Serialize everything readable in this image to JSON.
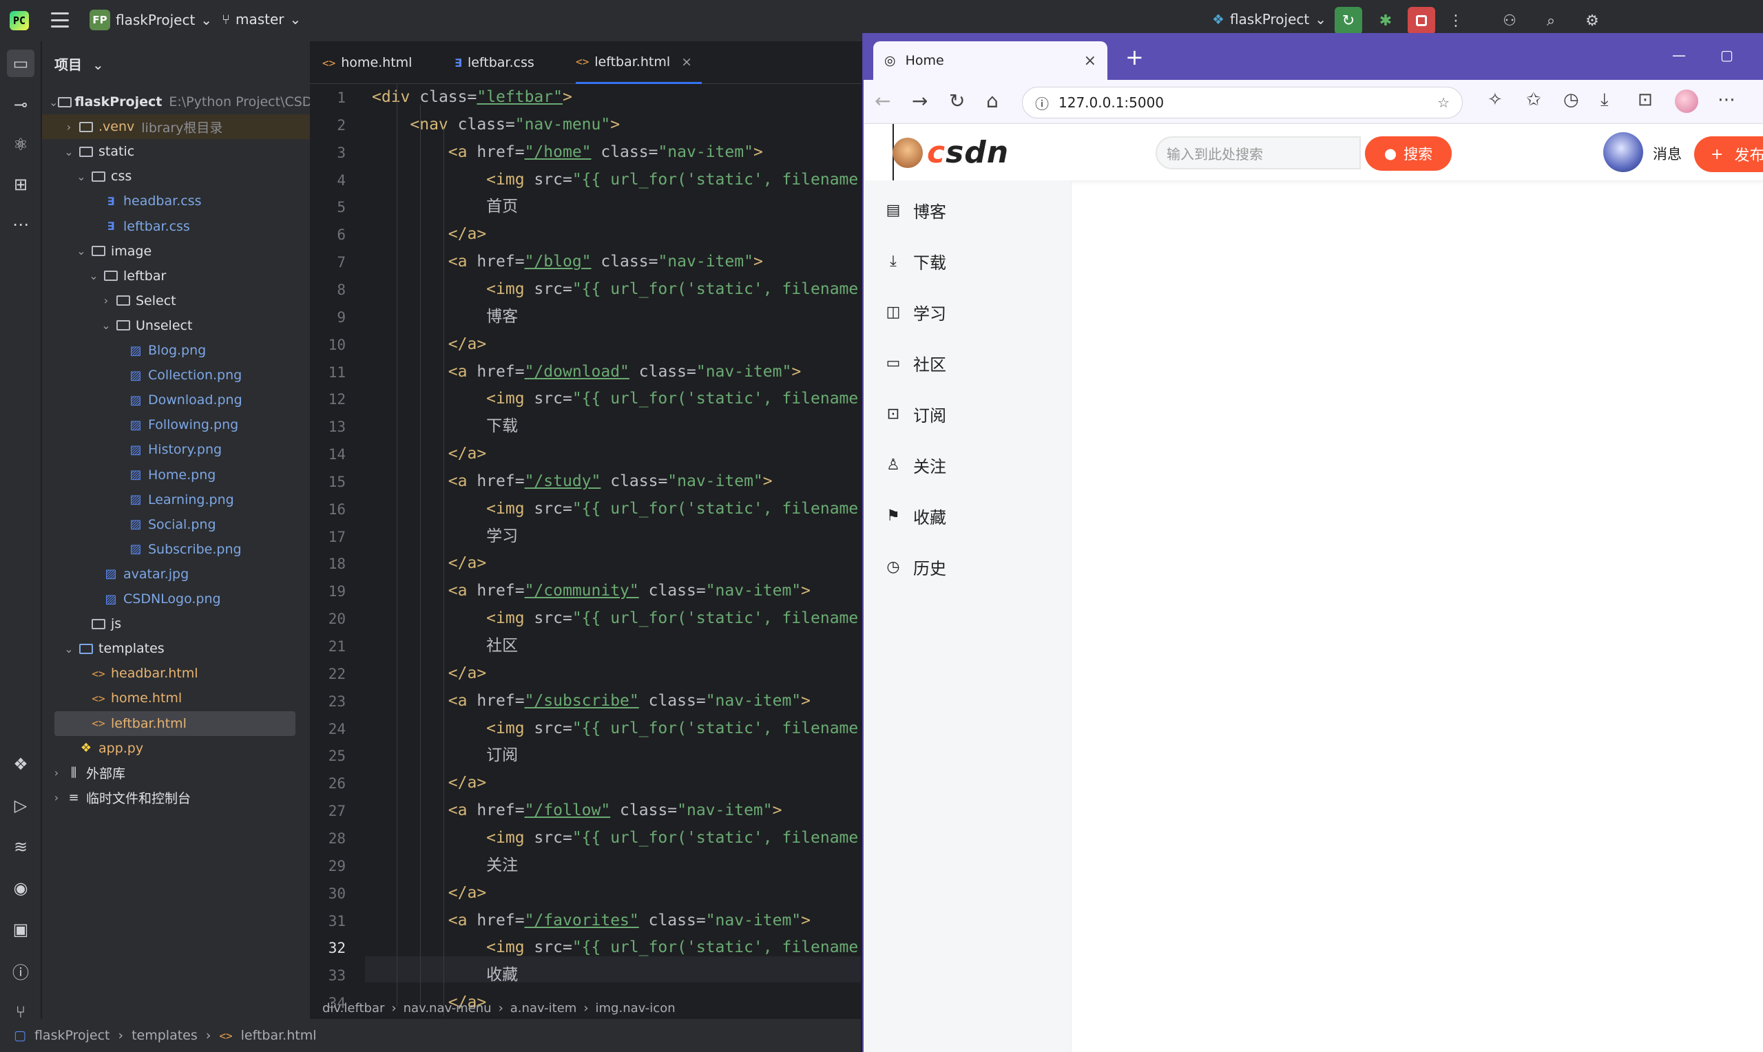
{
  "ide": {
    "logo_text": "PC",
    "project_badge": "FP",
    "project_name": "flaskProject",
    "branch": "master",
    "run_config": "flaskProject",
    "panel_title": "项目",
    "tree": [
      {
        "label": "flaskProject",
        "extra": "E:\\Python Project\\CSDN",
        "depth": 0,
        "type": "folder",
        "open": true,
        "bold": true
      },
      {
        "label": ".venv",
        "extra": "library根目录",
        "depth": 1,
        "type": "folder",
        "open": false,
        "excluded": true
      },
      {
        "label": "static",
        "depth": 1,
        "type": "folder",
        "open": true
      },
      {
        "label": "css",
        "depth": 2,
        "type": "folder",
        "open": true
      },
      {
        "label": "headbar.css",
        "depth": 3,
        "type": "css"
      },
      {
        "label": "leftbar.css",
        "depth": 3,
        "type": "css"
      },
      {
        "label": "image",
        "depth": 2,
        "type": "folder",
        "open": true
      },
      {
        "label": "leftbar",
        "depth": 3,
        "type": "folder",
        "open": true
      },
      {
        "label": "Select",
        "depth": 4,
        "type": "folder",
        "open": false
      },
      {
        "label": "Unselect",
        "depth": 4,
        "type": "folder",
        "open": true
      },
      {
        "label": "Blog.png",
        "depth": 5,
        "type": "png"
      },
      {
        "label": "Collection.png",
        "depth": 5,
        "type": "png"
      },
      {
        "label": "Download.png",
        "depth": 5,
        "type": "png"
      },
      {
        "label": "Following.png",
        "depth": 5,
        "type": "png"
      },
      {
        "label": "History.png",
        "depth": 5,
        "type": "png"
      },
      {
        "label": "Home.png",
        "depth": 5,
        "type": "png"
      },
      {
        "label": "Learning.png",
        "depth": 5,
        "type": "png"
      },
      {
        "label": "Social.png",
        "depth": 5,
        "type": "png"
      },
      {
        "label": "Subscribe.png",
        "depth": 5,
        "type": "png"
      },
      {
        "label": "avatar.jpg",
        "depth": 3,
        "type": "png"
      },
      {
        "label": "CSDNLogo.png",
        "depth": 3,
        "type": "png"
      },
      {
        "label": "js",
        "depth": 2,
        "type": "folder",
        "open": null
      },
      {
        "label": "templates",
        "depth": 1,
        "type": "folder",
        "open": true,
        "blue": true
      },
      {
        "label": "headbar.html",
        "depth": 2,
        "type": "html"
      },
      {
        "label": "home.html",
        "depth": 2,
        "type": "html"
      },
      {
        "label": "leftbar.html",
        "depth": 2,
        "type": "html",
        "selected": true
      },
      {
        "label": "app.py",
        "depth": 1,
        "type": "py"
      },
      {
        "label": "外部库",
        "depth": 0,
        "type": "lib",
        "open": false
      },
      {
        "label": "临时文件和控制台",
        "depth": 0,
        "type": "scratch",
        "open": false
      }
    ],
    "tabs": [
      {
        "label": "home.html",
        "type": "html"
      },
      {
        "label": "leftbar.css",
        "type": "css"
      },
      {
        "label": "leftbar.html",
        "type": "html",
        "active": true
      }
    ],
    "current_line": 32,
    "code": [
      [
        [
          "tg",
          "<div "
        ],
        [
          "at",
          "class="
        ],
        [
          "av",
          "\"leftbar\""
        ],
        [
          "tg",
          ">"
        ]
      ],
      [
        [
          "cn",
          "    "
        ],
        [
          "tg",
          "<nav "
        ],
        [
          "at",
          "class="
        ],
        [
          "av",
          "\"nav-menu\""
        ],
        [
          "tg",
          ">"
        ]
      ],
      [
        [
          "cn",
          "        "
        ],
        [
          "tg",
          "<a "
        ],
        [
          "at",
          "href="
        ],
        [
          "av",
          "\"/home\""
        ],
        [
          "at",
          " class="
        ],
        [
          "av",
          "\"nav-item\""
        ],
        [
          "tg",
          ">"
        ]
      ],
      [
        [
          "cn",
          "            "
        ],
        [
          "tg",
          "<img "
        ],
        [
          "at",
          "src="
        ],
        [
          "av",
          "\"{{ url_for("
        ],
        [
          "av",
          "'static'"
        ],
        [
          "av",
          ", filename"
        ]
      ],
      [
        [
          "cn",
          "            首页"
        ]
      ],
      [
        [
          "cn",
          "        "
        ],
        [
          "tg",
          "</a>"
        ]
      ],
      [
        [
          "cn",
          "        "
        ],
        [
          "tg",
          "<a "
        ],
        [
          "at",
          "href="
        ],
        [
          "av",
          "\"/blog\""
        ],
        [
          "at",
          " class="
        ],
        [
          "av",
          "\"nav-item\""
        ],
        [
          "tg",
          ">"
        ]
      ],
      [
        [
          "cn",
          "            "
        ],
        [
          "tg",
          "<img "
        ],
        [
          "at",
          "src="
        ],
        [
          "av",
          "\"{{ url_for("
        ],
        [
          "av",
          "'static'"
        ],
        [
          "av",
          ", filename"
        ]
      ],
      [
        [
          "cn",
          "            博客"
        ]
      ],
      [
        [
          "cn",
          "        "
        ],
        [
          "tg",
          "</a>"
        ]
      ],
      [
        [
          "cn",
          "        "
        ],
        [
          "tg",
          "<a "
        ],
        [
          "at",
          "href="
        ],
        [
          "av",
          "\"/download\""
        ],
        [
          "at",
          " class="
        ],
        [
          "av",
          "\"nav-item\""
        ],
        [
          "tg",
          ">"
        ]
      ],
      [
        [
          "cn",
          "            "
        ],
        [
          "tg",
          "<img "
        ],
        [
          "at",
          "src="
        ],
        [
          "av",
          "\"{{ url_for("
        ],
        [
          "av",
          "'static'"
        ],
        [
          "av",
          ", filename"
        ]
      ],
      [
        [
          "cn",
          "            下载"
        ]
      ],
      [
        [
          "cn",
          "        "
        ],
        [
          "tg",
          "</a>"
        ]
      ],
      [
        [
          "cn",
          "        "
        ],
        [
          "tg",
          "<a "
        ],
        [
          "at",
          "href="
        ],
        [
          "av",
          "\"/study\""
        ],
        [
          "at",
          " class="
        ],
        [
          "av",
          "\"nav-item\""
        ],
        [
          "tg",
          ">"
        ]
      ],
      [
        [
          "cn",
          "            "
        ],
        [
          "tg",
          "<img "
        ],
        [
          "at",
          "src="
        ],
        [
          "av",
          "\"{{ url_for("
        ],
        [
          "av",
          "'static'"
        ],
        [
          "av",
          ", filename"
        ]
      ],
      [
        [
          "cn",
          "            学习"
        ]
      ],
      [
        [
          "cn",
          "        "
        ],
        [
          "tg",
          "</a>"
        ]
      ],
      [
        [
          "cn",
          "        "
        ],
        [
          "tg",
          "<a "
        ],
        [
          "at",
          "href="
        ],
        [
          "av",
          "\"/community\""
        ],
        [
          "at",
          " class="
        ],
        [
          "av",
          "\"nav-item\""
        ],
        [
          "tg",
          ">"
        ]
      ],
      [
        [
          "cn",
          "            "
        ],
        [
          "tg",
          "<img "
        ],
        [
          "at",
          "src="
        ],
        [
          "av",
          "\"{{ url_for("
        ],
        [
          "av",
          "'static'"
        ],
        [
          "av",
          ", filename"
        ]
      ],
      [
        [
          "cn",
          "            社区"
        ]
      ],
      [
        [
          "cn",
          "        "
        ],
        [
          "tg",
          "</a>"
        ]
      ],
      [
        [
          "cn",
          "        "
        ],
        [
          "tg",
          "<a "
        ],
        [
          "at",
          "href="
        ],
        [
          "av",
          "\"/subscribe\""
        ],
        [
          "at",
          " class="
        ],
        [
          "av",
          "\"nav-item\""
        ],
        [
          "tg",
          ">"
        ]
      ],
      [
        [
          "cn",
          "            "
        ],
        [
          "tg",
          "<img "
        ],
        [
          "at",
          "src="
        ],
        [
          "av",
          "\"{{ url_for("
        ],
        [
          "av",
          "'static'"
        ],
        [
          "av",
          ", filename"
        ]
      ],
      [
        [
          "cn",
          "            订阅"
        ]
      ],
      [
        [
          "cn",
          "        "
        ],
        [
          "tg",
          "</a>"
        ]
      ],
      [
        [
          "cn",
          "        "
        ],
        [
          "tg",
          "<a "
        ],
        [
          "at",
          "href="
        ],
        [
          "av",
          "\"/follow\""
        ],
        [
          "at",
          " class="
        ],
        [
          "av",
          "\"nav-item\""
        ],
        [
          "tg",
          ">"
        ]
      ],
      [
        [
          "cn",
          "            "
        ],
        [
          "tg",
          "<img "
        ],
        [
          "at",
          "src="
        ],
        [
          "av",
          "\"{{ url_for("
        ],
        [
          "av",
          "'static'"
        ],
        [
          "av",
          ", filename"
        ]
      ],
      [
        [
          "cn",
          "            关注"
        ]
      ],
      [
        [
          "cn",
          "        "
        ],
        [
          "tg",
          "</a>"
        ]
      ],
      [
        [
          "cn",
          "        "
        ],
        [
          "tg",
          "<a "
        ],
        [
          "at",
          "href="
        ],
        [
          "av",
          "\"/favorites\""
        ],
        [
          "at",
          " class="
        ],
        [
          "av",
          "\"nav-item\""
        ],
        [
          "tg",
          ">"
        ]
      ],
      [
        [
          "cn",
          "            "
        ],
        [
          "tg",
          "<img "
        ],
        [
          "at",
          "src="
        ],
        [
          "av",
          "\"{{ url_for("
        ],
        [
          "av",
          "'static'"
        ],
        [
          "av",
          ", filename"
        ]
      ],
      [
        [
          "cn",
          "            收藏"
        ]
      ],
      [
        [
          "cn",
          "        "
        ],
        [
          "tg",
          "</a>"
        ]
      ]
    ],
    "breadcrumb": [
      "div.leftbar",
      "nav.nav-menu",
      "a.nav-item",
      "img.nav-icon"
    ],
    "status_path": [
      "flaskProject",
      "templates",
      "leftbar.html"
    ]
  },
  "browser": {
    "tab_title": "Home",
    "url": "127.0.0.1:5000",
    "page": {
      "search_placeholder": "输入到此处搜索",
      "search_button": "搜索",
      "messages": "消息",
      "publish": "发布",
      "nav": [
        {
          "label": "博客",
          "icon": "blog-icon",
          "glyph": "▤"
        },
        {
          "label": "下载",
          "icon": "download-icon",
          "glyph": "⤓"
        },
        {
          "label": "学习",
          "icon": "learning-icon",
          "glyph": "◫"
        },
        {
          "label": "社区",
          "icon": "social-icon",
          "glyph": "▭"
        },
        {
          "label": "订阅",
          "icon": "subscribe-icon",
          "glyph": "⊡"
        },
        {
          "label": "关注",
          "icon": "following-icon",
          "glyph": "♙"
        },
        {
          "label": "收藏",
          "icon": "collection-icon",
          "glyph": "⚑"
        },
        {
          "label": "历史",
          "icon": "history-icon",
          "glyph": "◷"
        }
      ]
    }
  },
  "colors": {
    "accent": "#3574f0",
    "csdn_red": "#fc5531",
    "browser_frame": "#5b4fb4"
  }
}
